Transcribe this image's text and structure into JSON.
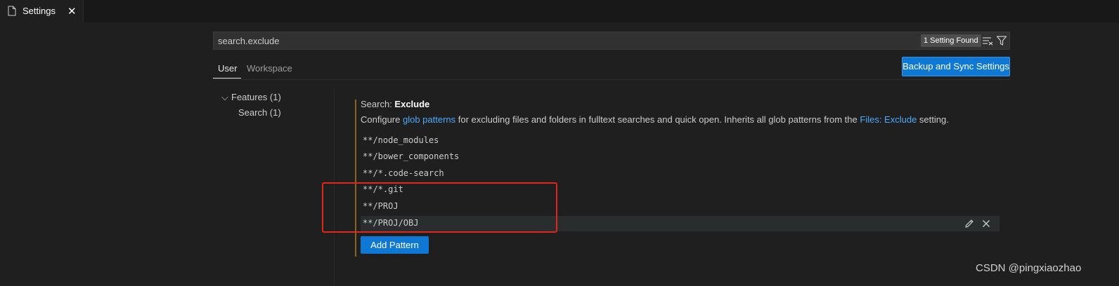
{
  "tab": {
    "label": "Settings",
    "close_glyph": "✕",
    "icon": "file-icon"
  },
  "search": {
    "value": "search.exclude",
    "result_count": "1 Setting Found"
  },
  "scopes": {
    "user": "User",
    "workspace": "Workspace"
  },
  "sync_button": "Backup and Sync Settings",
  "toc": {
    "chevron": "⌵",
    "features": "Features (1)",
    "search": "Search (1)"
  },
  "setting": {
    "category": "Search: ",
    "name": "Exclude",
    "desc_prefix": "Configure ",
    "link_glob": "glob patterns",
    "desc_middle": " for excluding files and folders in fulltext searches and quick open. Inherits all glob patterns from the ",
    "link_files_exclude": "Files: Exclude",
    "desc_suffix": " setting.",
    "patterns": [
      "**/node_modules",
      "**/bower_components",
      "**/*.code-search",
      "**/*.git",
      "**/PROJ",
      "**/PROJ/OBJ"
    ],
    "add_button": "Add Pattern"
  },
  "watermark": "CSDN @pingxiaozhao",
  "colors": {
    "accent_blue": "#0e78d4",
    "link_blue": "#4daafc",
    "modified_indicator": "#8a6322",
    "annotation_red": "#e0251b"
  }
}
